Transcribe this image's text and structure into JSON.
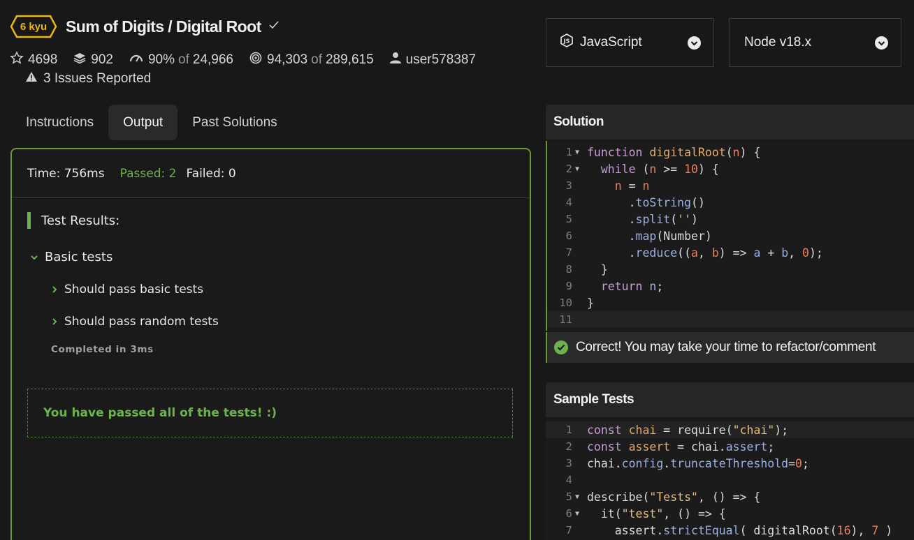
{
  "kata": {
    "rank": "6 kyu",
    "title": "Sum of Digits / Digital Root",
    "stats": {
      "stars": "4698",
      "collections": "902",
      "satisfaction": "90%",
      "satisfaction_of": "of",
      "votes": "24,966",
      "completed": "94,303",
      "completed_of": "of",
      "attempts": "289,615",
      "author": "user578387"
    },
    "issues": "3 Issues Reported"
  },
  "tabs": [
    {
      "label": "Instructions",
      "active": false
    },
    {
      "label": "Output",
      "active": true
    },
    {
      "label": "Past Solutions",
      "active": false
    }
  ],
  "output": {
    "time": "Time: 756ms",
    "passed": "Passed: 2",
    "failed": "Failed: 0",
    "results_heading": "Test Results:",
    "group": "Basic tests",
    "tests": [
      "Should pass basic tests",
      "Should pass random tests"
    ],
    "completed": "Completed in 3ms",
    "success_message": "You have passed all of the tests! :)"
  },
  "language_select": {
    "value": "JavaScript"
  },
  "runtime_select": {
    "value": "Node v18.x"
  },
  "solution": {
    "heading": "Solution",
    "line_numbers": [
      "1",
      "2",
      "3",
      "4",
      "5",
      "6",
      "7",
      "8",
      "9",
      "10",
      "11"
    ],
    "correct_message": "Correct! You may take your time to refactor/comment"
  },
  "sample_tests": {
    "heading": "Sample Tests",
    "line_numbers": [
      "1",
      "2",
      "3",
      "4",
      "5",
      "6",
      "7"
    ]
  },
  "colors": {
    "accent_green": "#6bb34a",
    "border_green": "#6b9a32",
    "kyu_yellow": "#ecb613",
    "background": "#181818"
  }
}
